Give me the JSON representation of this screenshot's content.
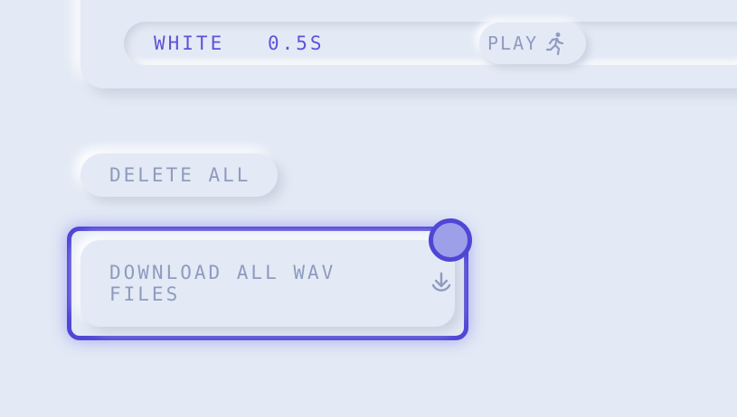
{
  "track": {
    "name": "WHITE",
    "duration": "0.5S",
    "play_label": "PLAY"
  },
  "actions": {
    "delete_all_label": "DELETE ALL",
    "download_all_label": "DOWNLOAD ALL WAV FILES"
  },
  "icons": {
    "play": "running-person-icon",
    "download": "download-icon"
  },
  "colors": {
    "background": "#e3eaf5",
    "accent": "#5c54d9",
    "muted_text": "#8f9bbf",
    "focus_ring": "#4f46d6",
    "focus_dot_fill": "#9da0e8"
  }
}
